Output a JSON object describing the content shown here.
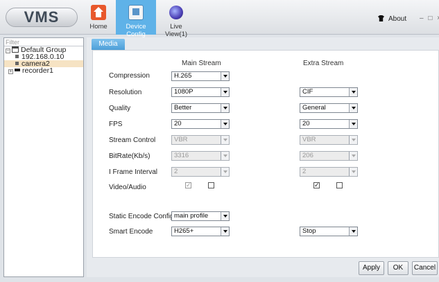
{
  "app": {
    "logo": "VMS"
  },
  "nav": {
    "home": "Home",
    "device_config": "Device Config",
    "live_view": "Live View(1)",
    "about": "About",
    "window_controls": "– □ ×"
  },
  "sidebar": {
    "filter_placeholder": "Filter",
    "group": "Default Group",
    "items": [
      {
        "label": "192.168.0.10"
      },
      {
        "label": "camera2"
      },
      {
        "label": "recorder1"
      }
    ]
  },
  "tab": {
    "media": "Media"
  },
  "columns": {
    "main": "Main Stream",
    "extra": "Extra Stream"
  },
  "labels": {
    "compression": "Compression",
    "resolution": "Resolution",
    "quality": "Quality",
    "fps": "FPS",
    "stream_control": "Stream Control",
    "bitrate": "BitRate(Kb/s)",
    "iframe": "I Frame Interval",
    "video_audio": "Video/Audio",
    "static_encode": "Static Encode Config",
    "smart_encode": "Smart Encode"
  },
  "main_stream": {
    "compression": "H.265",
    "resolution": "1080P",
    "quality": "Better",
    "fps": "20",
    "stream_control": "VBR",
    "bitrate": "3316",
    "iframe": "2",
    "video_checked": true,
    "audio_checked": false,
    "static_encode": "main profile",
    "smart_encode": "H265+"
  },
  "extra_stream": {
    "resolution": "CIF",
    "quality": "General",
    "fps": "20",
    "stream_control": "VBR",
    "bitrate": "206",
    "iframe": "2",
    "video_checked": true,
    "audio_checked": false,
    "smart_encode": "Stop"
  },
  "buttons": {
    "apply": "Apply",
    "ok": "OK",
    "cancel": "Cancel"
  }
}
